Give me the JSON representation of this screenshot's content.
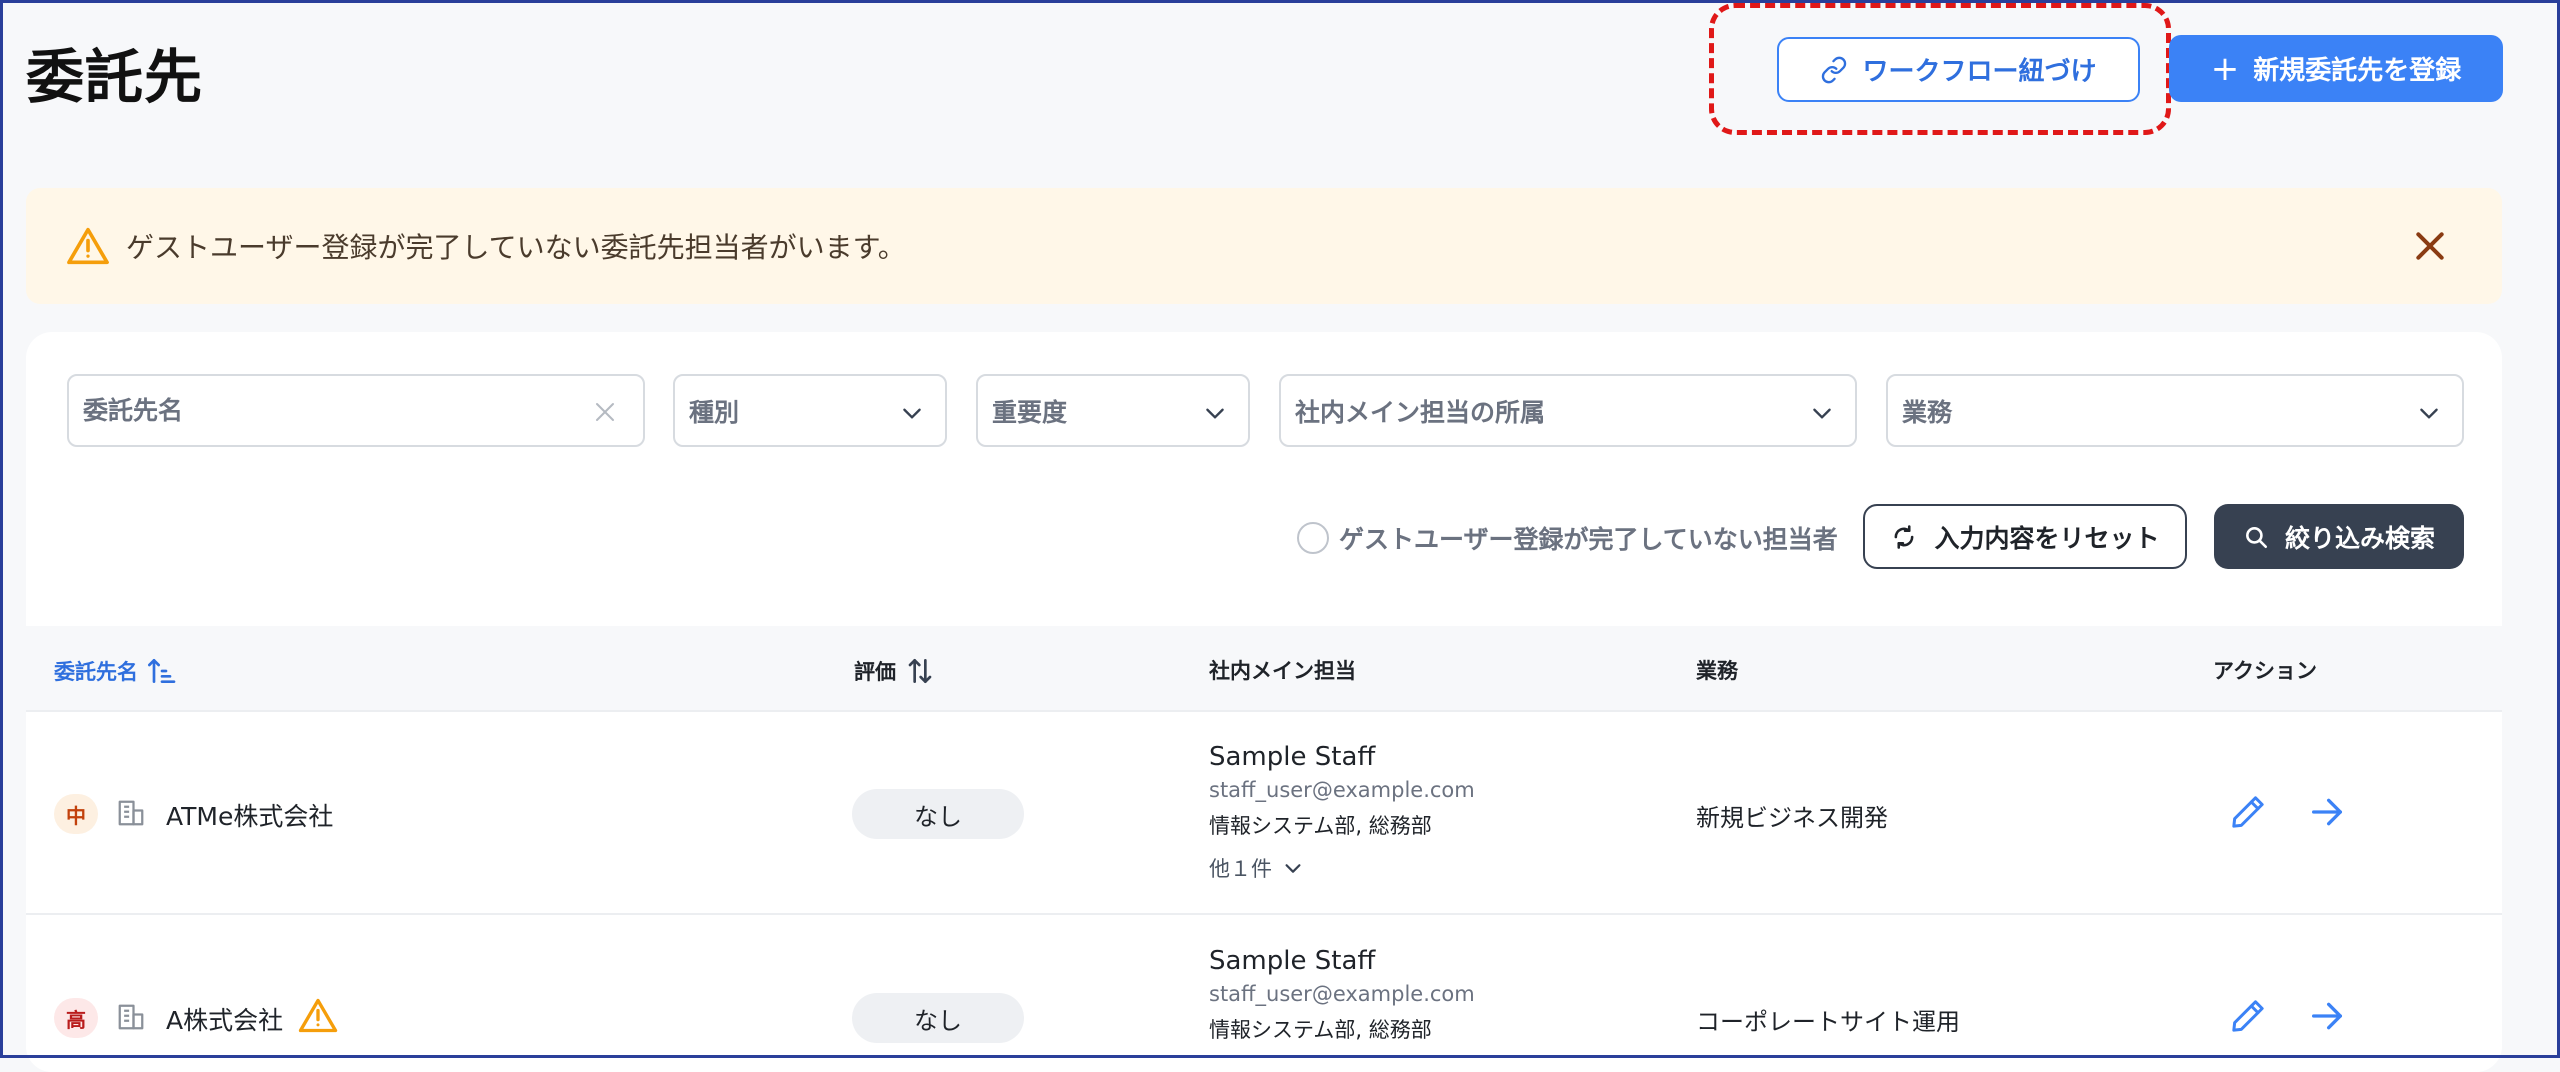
{
  "page": {
    "title": "委託先"
  },
  "header": {
    "workflow_button": "ワークフロー紐づけ",
    "new_button": "新規委託先を登録"
  },
  "alert": {
    "message": "ゲストユーザー登録が完了していない委託先担当者がいます。"
  },
  "filters": {
    "name_placeholder": "委託先名",
    "type_placeholder": "種別",
    "importance_placeholder": "重要度",
    "department_placeholder": "社内メイン担当の所属",
    "business_placeholder": "業務",
    "guest_checkbox_label": "ゲストユーザー登録が完了していない担当者",
    "reset_button": "入力内容をリセット",
    "search_button": "絞り込み検索"
  },
  "table": {
    "columns": {
      "name": "委託先名",
      "evaluation": "評価",
      "main_staff": "社内メイン担当",
      "business": "業務",
      "action": "アクション"
    },
    "rows": [
      {
        "importance": "中",
        "name": "ATMe株式会社",
        "evaluation": "なし",
        "staff_name": "Sample Staff",
        "staff_email": "staff_user@example.com",
        "staff_dept": "情報システム部, 総務部",
        "staff_more": "他１件",
        "business": "新規ビジネス開発"
      },
      {
        "importance": "高",
        "name": "A株式会社",
        "evaluation": "なし",
        "staff_name": "Sample Staff",
        "staff_email": "staff_user@example.com",
        "staff_dept": "情報システム部, 総務部",
        "business": "コーポレートサイト運用"
      }
    ]
  },
  "colors": {
    "primary": "#3b82f6",
    "highlight": "#e01818",
    "alert_bg": "#fff7e8",
    "warning": "#f59e0b",
    "dark_button": "#374151",
    "badge_medium_bg": "#fdf0e1",
    "badge_medium_text": "#c2410c",
    "badge_high_bg": "#fde8e8",
    "badge_high_text": "#b91c1c"
  }
}
